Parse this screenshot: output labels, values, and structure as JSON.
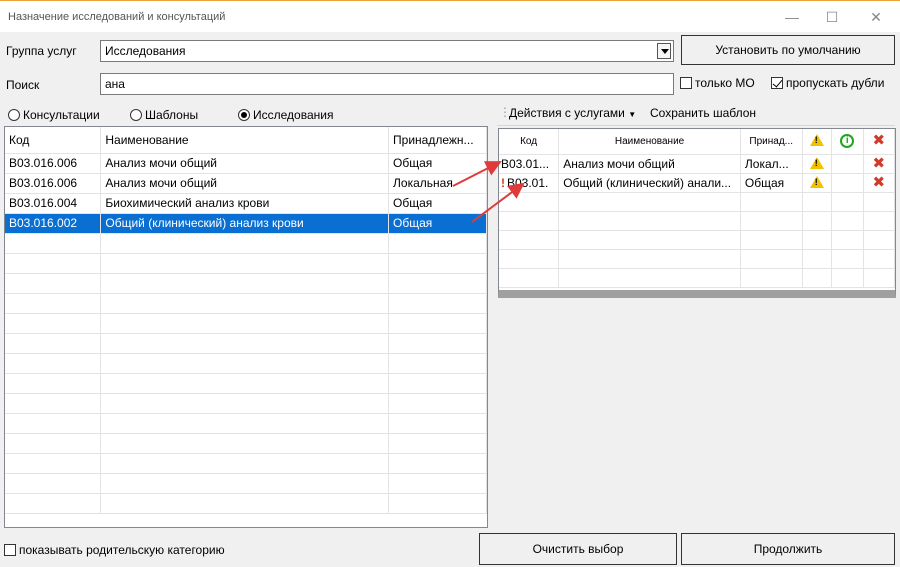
{
  "window": {
    "title": "Назначение исследований и консультаций",
    "minimize": "—",
    "maximize": "☐",
    "close": "✕"
  },
  "group": {
    "label": "Группа услуг",
    "value": "Исследования"
  },
  "default_button": "Установить по умолчанию",
  "search": {
    "label": "Поиск",
    "value": "ана"
  },
  "only_mo": "только МО",
  "skip_dupes": "пропускать дубли",
  "radios": {
    "consult": "Консультации",
    "templates": "Шаблоны",
    "research": "Исследования"
  },
  "left_table": {
    "headers": [
      "Код",
      "Наименование",
      "Принадлежн..."
    ],
    "rows": [
      [
        "B03.016.006",
        "Анализ мочи общий",
        "Общая"
      ],
      [
        "B03.016.006",
        "Анализ мочи общий",
        "Локальная"
      ],
      [
        "B03.016.004",
        "Биохимический анализ крови",
        "Общая"
      ],
      [
        "B03.016.002",
        "Общий (клинический) анализ крови",
        "Общая"
      ]
    ]
  },
  "right_toolbar": {
    "actions": "Действия с услугами",
    "save": "Сохранить шаблон"
  },
  "right_table": {
    "headers": [
      "Код",
      "Наименование",
      "Принад..."
    ],
    "rows": [
      {
        "mark": "",
        "code": "B03.01...",
        "name": "Анализ мочи общий",
        "owner": "Локал..."
      },
      {
        "mark": "!",
        "code": "B03.01.",
        "name": "Общий (клинический) анали...",
        "owner": "Общая"
      }
    ]
  },
  "show_parent": "показывать родительскую категорию",
  "clear_button": "Очистить выбор",
  "continue_button": "Продолжить",
  "colors": {
    "selection": "#0a6fd3",
    "annotation_arrow": "#e03a3a",
    "warning": "#f2c100",
    "info": "#1aa81a",
    "delete": "#d23b2b"
  }
}
